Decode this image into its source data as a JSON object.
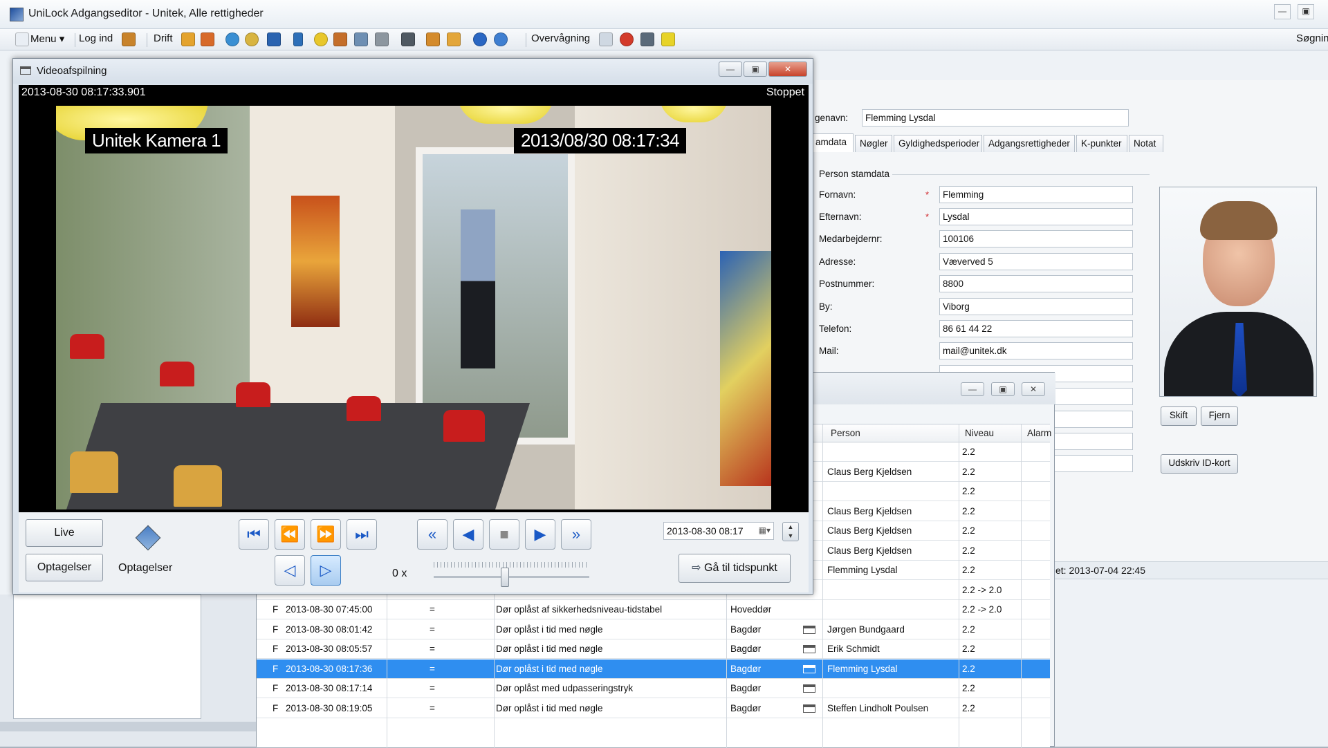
{
  "app": {
    "title": "UniLock Adgangseditor - Unitek, Alle rettigheder"
  },
  "toolbar": {
    "menu_label": "Menu",
    "menu_arrow": "▾",
    "login_label": "Log ind",
    "drift_label": "Drift",
    "monitor_label": "Overvågning",
    "search_label": "Søgnin"
  },
  "editor": {
    "name_label": "genavn:",
    "name_value": "Flemming Lysdal",
    "tabs": [
      {
        "label": "amdata"
      },
      {
        "label": "Nøgler"
      },
      {
        "label": "Gyldighedsperioder"
      },
      {
        "label": "Adgangsrettigheder"
      },
      {
        "label": "K-punkter"
      },
      {
        "label": "Notat"
      }
    ],
    "section_title": "Person stamdata",
    "fields": [
      {
        "label": "Fornavn:",
        "value": "Flemming"
      },
      {
        "label": "Efternavn:",
        "value": "Lysdal"
      },
      {
        "label": "Medarbejdernr:",
        "value": "100106"
      },
      {
        "label": "Adresse:",
        "value": "Væverved 5"
      },
      {
        "label": "Postnummer:",
        "value": "8800"
      },
      {
        "label": "By:",
        "value": "Viborg"
      },
      {
        "label": "Telefon:",
        "value": "86 61 44 22"
      },
      {
        "label": "Mail:",
        "value": "mail@unitek.dk"
      }
    ],
    "required_mark": "*",
    "change_photo_label": "Skift",
    "remove_photo_label": "Fjern",
    "print_id_label": "Udskriv ID-kort",
    "status_text": "et: 2013-07-04  22:45"
  },
  "events": {
    "headers": {
      "person": "Person",
      "level": "Niveau",
      "alarm": "Alarm"
    },
    "upper_rows": [
      {
        "person": "",
        "level": "2.2"
      },
      {
        "person": "Claus Berg Kjeldsen",
        "level": "2.2"
      },
      {
        "person": "",
        "level": "2.2"
      },
      {
        "person": "Claus Berg Kjeldsen",
        "level": "2.2"
      },
      {
        "person": "Claus Berg Kjeldsen",
        "level": "2.2"
      },
      {
        "person": "Claus Berg Kjeldsen",
        "level": "2.2"
      },
      {
        "person": "Flemming Lysdal",
        "level": "2.2"
      },
      {
        "person": "",
        "level": "2.2 -> 2.0"
      }
    ],
    "rows": [
      {
        "flag": "F",
        "time": "2013-08-30  07:45:00",
        "eq": "=",
        "text": "Dør oplåst af sikkerhedsniveau-tidstabel",
        "door": "Hoveddør",
        "icon": false,
        "person": "",
        "level": "2.2 -> 2.0",
        "selected": false
      },
      {
        "flag": "F",
        "time": "2013-08-30  08:01:42",
        "eq": "=",
        "text": "Dør oplåst i tid med nøgle",
        "door": "Bagdør",
        "icon": true,
        "person": "Jørgen Bundgaard",
        "level": "2.2",
        "selected": false
      },
      {
        "flag": "F",
        "time": "2013-08-30  08:05:57",
        "eq": "=",
        "text": "Dør oplåst i tid med nøgle",
        "door": "Bagdør",
        "icon": true,
        "person": "Erik Schmidt",
        "level": "2.2",
        "selected": false
      },
      {
        "flag": "F",
        "time": "2013-08-30  08:17:36",
        "eq": "=",
        "text": "Dør oplåst i tid med nøgle",
        "door": "Bagdør",
        "icon": true,
        "person": "Flemming Lysdal",
        "level": "2.2",
        "selected": true
      },
      {
        "flag": "F",
        "time": "2013-08-30  08:17:14",
        "eq": "=",
        "text": "Dør oplåst med udpasseringstryk",
        "door": "Bagdør",
        "icon": true,
        "person": "",
        "level": "2.2",
        "selected": false
      },
      {
        "flag": "F",
        "time": "2013-08-30  08:19:05",
        "eq": "=",
        "text": "Dør oplåst i tid med nøgle",
        "door": "Bagdør",
        "icon": true,
        "person": "Steffen Lindholt Poulsen",
        "level": "2.2",
        "selected": false
      }
    ]
  },
  "video": {
    "window_title": "Videoafspilning",
    "timestamp": "2013-08-30  08:17:33.901",
    "state": "Stoppet",
    "camera_label": "Unitek Kamera 1",
    "overlay_time": "2013/08/30   08:17:34",
    "live_label": "Live",
    "recordings_label": "Optagelser",
    "recordings_caption": "Optagelser",
    "speed_label": "0 x",
    "speed_value": 0,
    "datetime_value": "2013-08-30   08:17",
    "goto_label": "Gå til tidspunkt"
  },
  "colors": {
    "selection": "#2f8ef0",
    "required": "#d0262b"
  }
}
